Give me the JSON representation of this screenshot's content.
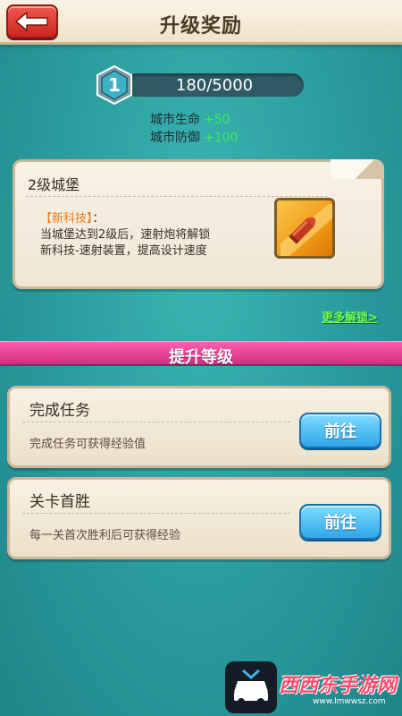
{
  "header": {
    "title": "升级奖励",
    "back_icon": "back-arrow-icon"
  },
  "level": {
    "number": "1",
    "progress_text": "180/5000",
    "progress_fraction": 0.036,
    "stats": [
      {
        "label": "城市生命",
        "value": "+50"
      },
      {
        "label": "城市防御",
        "value": "+100"
      }
    ]
  },
  "reward_card": {
    "title": "2级城堡",
    "tag": "【新科技】",
    "tag_suffix": "：",
    "lines": [
      "当城堡达到2级后，速射炮将解锁",
      "新科技-速射装置，提高设计速度"
    ],
    "icon": "bullet-icon"
  },
  "more_link": "更多解锁>",
  "section": {
    "title": "提升等级"
  },
  "tasks": [
    {
      "title": "完成任务",
      "desc": "完成任务可获得经验值",
      "button": "前往"
    },
    {
      "title": "关卡首胜",
      "desc": "每一关首次胜利后可获得经验",
      "button": "前往"
    }
  ],
  "watermark": {
    "text": "西西东手游网",
    "sub": "www.lmwwsz.com"
  },
  "colors": {
    "background": "#2a9a9c",
    "stat_value": "#3eea5a",
    "tech_tag": "#e97a1c",
    "section_band": "#e0408f",
    "go_button": "#2fa6e8",
    "back_button": "#d8322a"
  }
}
